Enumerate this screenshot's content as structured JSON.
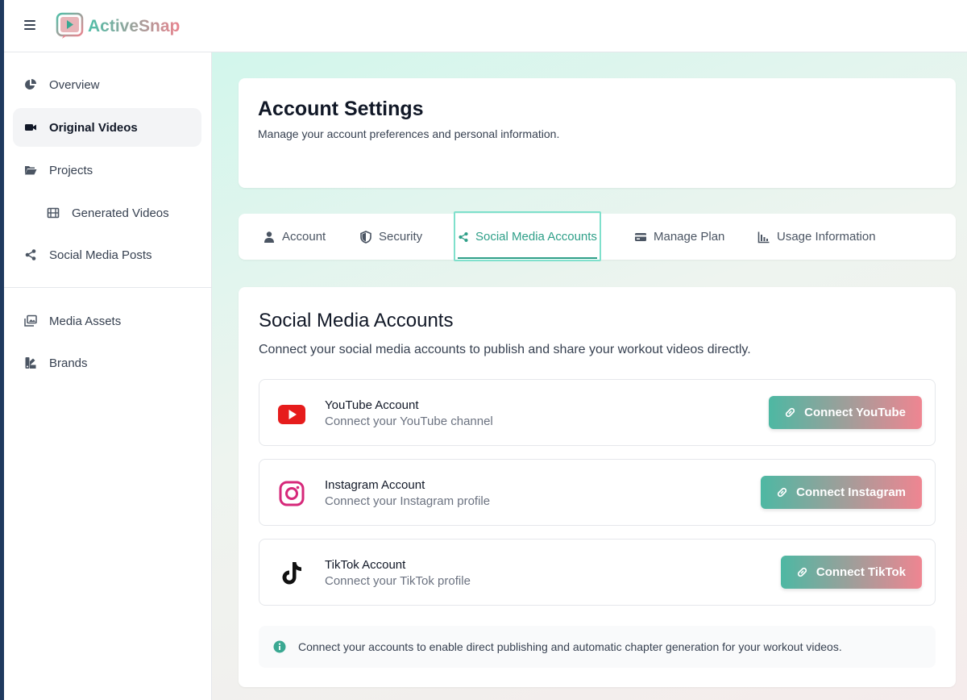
{
  "app": {
    "name": "ActiveSnap"
  },
  "sidebar": {
    "items": [
      {
        "label": "Overview",
        "icon": "pie-chart-icon",
        "active": false
      },
      {
        "label": "Original Videos",
        "icon": "video-camera-icon",
        "active": true
      },
      {
        "label": "Projects",
        "icon": "folder-open-icon",
        "active": false
      },
      {
        "label": "Generated Videos",
        "icon": "film-icon",
        "active": false,
        "sub": true
      },
      {
        "label": "Social Media Posts",
        "icon": "share-icon",
        "active": false
      },
      {
        "label": "Media Assets",
        "icon": "images-icon",
        "active": false
      },
      {
        "label": "Brands",
        "icon": "palette-icon",
        "active": false
      }
    ]
  },
  "header": {
    "title": "Account Settings",
    "subtitle": "Manage your account preferences and personal information."
  },
  "tabs": [
    {
      "label": "Account",
      "icon": "user-icon"
    },
    {
      "label": "Security",
      "icon": "shield-icon"
    },
    {
      "label": "Social Media Accounts",
      "icon": "share-icon",
      "active": true
    },
    {
      "label": "Manage Plan",
      "icon": "credit-card-icon"
    },
    {
      "label": "Usage Information",
      "icon": "bar-chart-icon"
    }
  ],
  "social": {
    "title": "Social Media Accounts",
    "subtitle": "Connect your social media accounts to publish and share your workout videos directly.",
    "accounts": [
      {
        "name": "YouTube Account",
        "desc": "Connect your YouTube channel",
        "button": "Connect YouTube",
        "icon": "youtube-icon",
        "color": "#e61c1c"
      },
      {
        "name": "Instagram Account",
        "desc": "Connect your Instagram profile",
        "button": "Connect Instagram",
        "icon": "instagram-icon",
        "color": "#d6287a"
      },
      {
        "name": "TikTok Account",
        "desc": "Connect your TikTok profile",
        "button": "Connect TikTok",
        "icon": "tiktok-icon",
        "color": "#111111"
      }
    ],
    "info": "Connect your accounts to enable direct publishing and automatic chapter generation for your workout videos."
  },
  "colors": {
    "accent": "#2e9f88",
    "gradient_start": "#4db8a3",
    "gradient_end": "#ef8591"
  }
}
